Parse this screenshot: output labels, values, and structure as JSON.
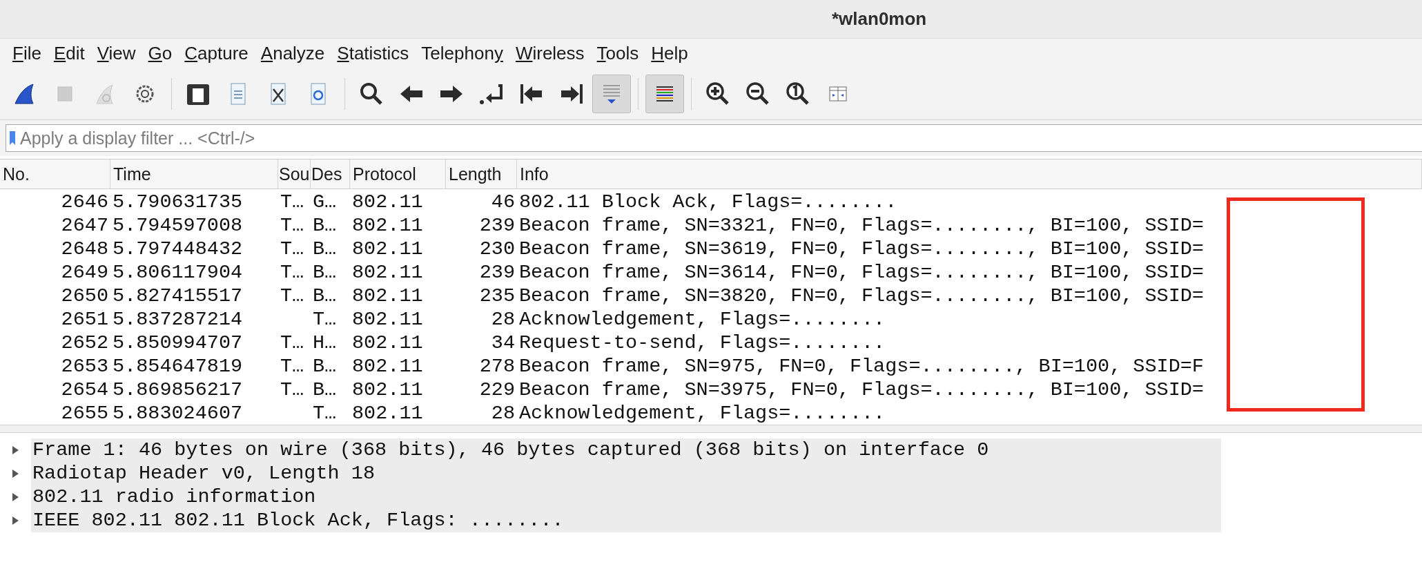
{
  "window": {
    "title": "*wlan0mon"
  },
  "menu": [
    {
      "key": "F",
      "post": "ile"
    },
    {
      "key": "E",
      "post": "dit"
    },
    {
      "key": "V",
      "post": "iew"
    },
    {
      "key": "G",
      "post": "o"
    },
    {
      "key": "C",
      "post": "apture"
    },
    {
      "key": "A",
      "post": "nalyze"
    },
    {
      "key": "S",
      "post": "tatistics"
    },
    {
      "pre": "Telephon",
      "key": "y"
    },
    {
      "key": "W",
      "post": "ireless"
    },
    {
      "key": "T",
      "post": "ools"
    },
    {
      "key": "H",
      "post": "elp"
    }
  ],
  "toolbar": [
    {
      "kind": "start",
      "pressed": false,
      "disabled": false
    },
    {
      "kind": "stop",
      "pressed": false,
      "disabled": true
    },
    {
      "kind": "restart",
      "pressed": false,
      "disabled": true
    },
    {
      "kind": "options",
      "pressed": false,
      "disabled": false
    },
    {
      "kind": "separator"
    },
    {
      "kind": "open",
      "pressed": false,
      "disabled": false
    },
    {
      "kind": "save",
      "pressed": false,
      "disabled": false
    },
    {
      "kind": "close",
      "pressed": false,
      "disabled": false
    },
    {
      "kind": "reload",
      "pressed": false,
      "disabled": false
    },
    {
      "kind": "separator"
    },
    {
      "kind": "find",
      "pressed": false,
      "disabled": false
    },
    {
      "kind": "back",
      "pressed": false,
      "disabled": false
    },
    {
      "kind": "forward",
      "pressed": false,
      "disabled": false
    },
    {
      "kind": "goto",
      "pressed": false,
      "disabled": false
    },
    {
      "kind": "first",
      "pressed": false,
      "disabled": false
    },
    {
      "kind": "last",
      "pressed": false,
      "disabled": false
    },
    {
      "kind": "autoscroll",
      "pressed": true,
      "disabled": false
    },
    {
      "kind": "separator"
    },
    {
      "kind": "colorize",
      "pressed": true,
      "disabled": false
    },
    {
      "kind": "separator"
    },
    {
      "kind": "zoom_in",
      "pressed": false,
      "disabled": false
    },
    {
      "kind": "zoom_out",
      "pressed": false,
      "disabled": false
    },
    {
      "kind": "zoom_reset",
      "pressed": false,
      "disabled": false
    },
    {
      "kind": "resize_columns",
      "pressed": false,
      "disabled": false
    }
  ],
  "filter": {
    "placeholder": "Apply a display filter ... <Ctrl-/>"
  },
  "packet_list": {
    "columns": [
      "No.",
      "Time",
      "Sou",
      "Des",
      "Protocol",
      "Length",
      "Info"
    ],
    "rows": [
      {
        "no": "2646",
        "time": "5.790631735",
        "source": "T…",
        "destination": "G…",
        "protocol": "802.11",
        "length": "46",
        "info": "802.11 Block Ack, Flags=........"
      },
      {
        "no": "2647",
        "time": "5.794597008",
        "source": "T…",
        "destination": "B…",
        "protocol": "802.11",
        "length": "239",
        "info": "Beacon frame, SN=3321, FN=0, Flags=........, BI=100, SSID="
      },
      {
        "no": "2648",
        "time": "5.797448432",
        "source": "T…",
        "destination": "B…",
        "protocol": "802.11",
        "length": "230",
        "info": "Beacon frame, SN=3619, FN=0, Flags=........, BI=100, SSID="
      },
      {
        "no": "2649",
        "time": "5.806117904",
        "source": "T…",
        "destination": "B…",
        "protocol": "802.11",
        "length": "239",
        "info": "Beacon frame, SN=3614, FN=0, Flags=........, BI=100, SSID="
      },
      {
        "no": "2650",
        "time": "5.827415517",
        "source": "T…",
        "destination": "B…",
        "protocol": "802.11",
        "length": "235",
        "info": "Beacon frame, SN=3820, FN=0, Flags=........, BI=100, SSID="
      },
      {
        "no": "2651",
        "time": "5.837287214",
        "destination": "T…",
        "protocol": "802.11",
        "length": "28",
        "info": "Acknowledgement, Flags=........"
      },
      {
        "no": "2652",
        "time": "5.850994707",
        "source": "T…",
        "destination": "H…",
        "protocol": "802.11",
        "length": "34",
        "info": "Request-to-send, Flags=........"
      },
      {
        "no": "2653",
        "time": "5.854647819",
        "source": "T…",
        "destination": "B…",
        "protocol": "802.11",
        "length": "278",
        "info": "Beacon frame, SN=975, FN=0, Flags=........, BI=100, SSID=F"
      },
      {
        "no": "2654",
        "time": "5.869856217",
        "source": "T…",
        "destination": "B…",
        "protocol": "802.11",
        "length": "229",
        "info": "Beacon frame, SN=3975, FN=0, Flags=........, BI=100, SSID="
      },
      {
        "no": "2655",
        "time": "5.883024607",
        "destination": "T…",
        "protocol": "802.11",
        "length": "28",
        "info": "Acknowledgement, Flags=........"
      }
    ]
  },
  "details": [
    {
      "label": "Frame 1: 46 bytes on wire (368 bits), 46 bytes captured (368 bits) on interface 0",
      "expanded": false
    },
    {
      "label": "Radiotap Header v0, Length 18",
      "expanded": false
    },
    {
      "label": "802.11 radio information",
      "expanded": false
    },
    {
      "label": "IEEE 802.11 802.11 Block Ack, Flags: ........",
      "expanded": false
    }
  ]
}
